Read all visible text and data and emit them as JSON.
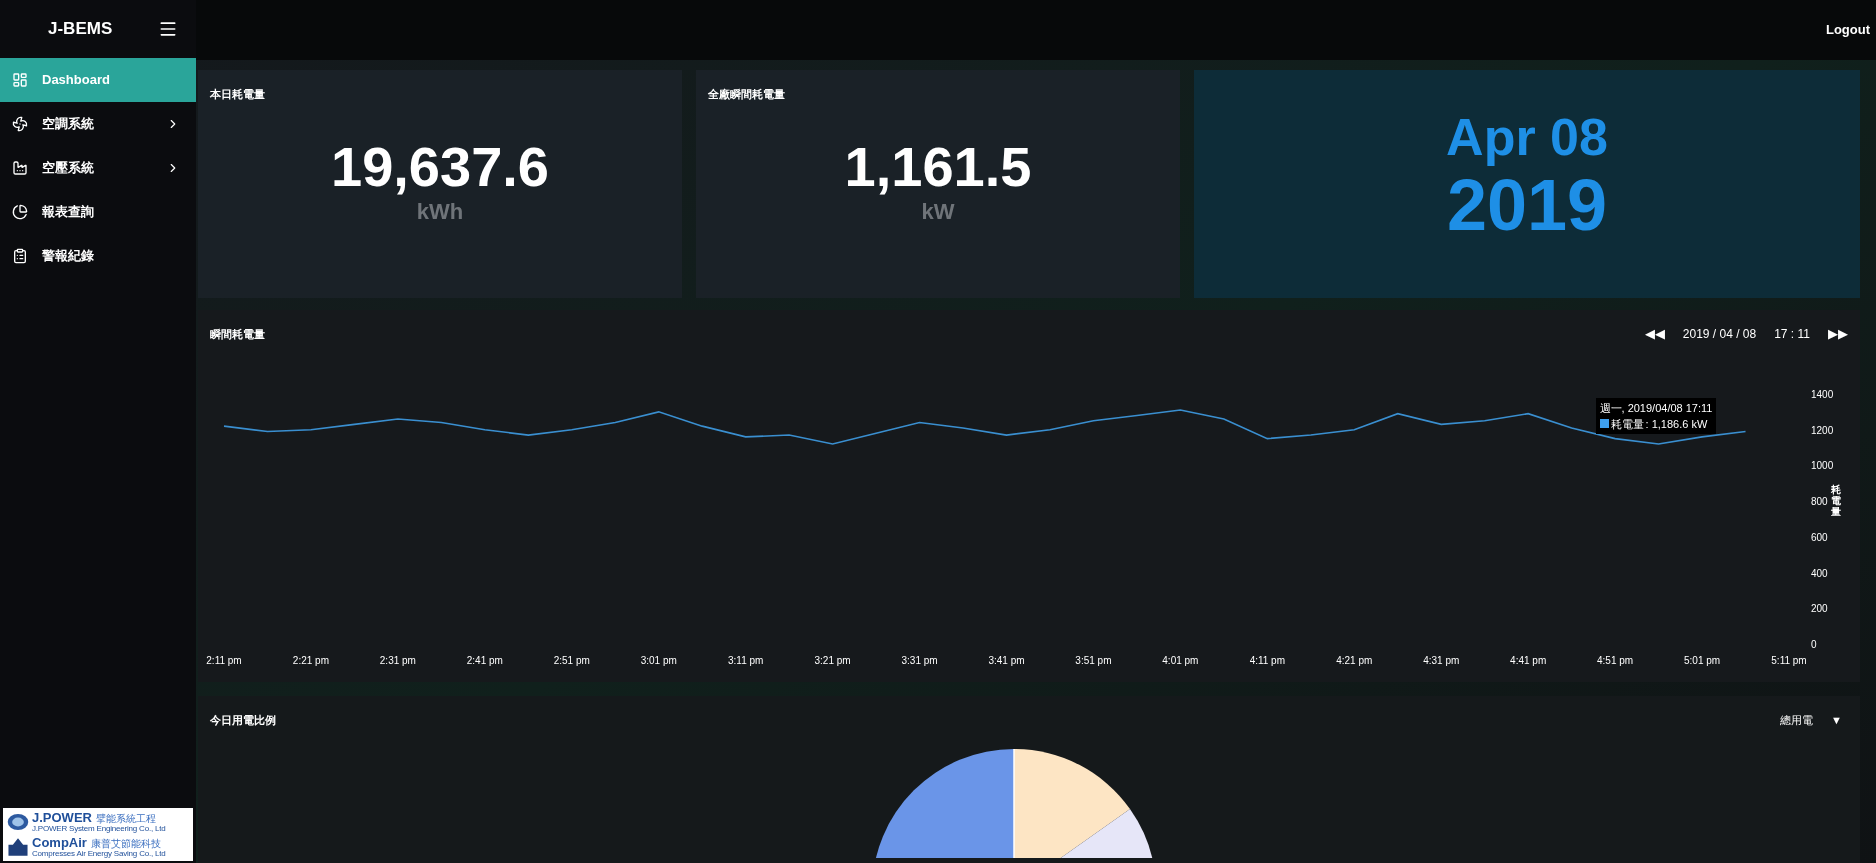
{
  "brand": "J-BEMS",
  "topbar": {
    "logout": "Logout"
  },
  "sidebar": {
    "items": [
      {
        "label": "Dashboard",
        "selected": true,
        "expandable": false
      },
      {
        "label": "空調系統",
        "selected": false,
        "expandable": true
      },
      {
        "label": "空壓系統",
        "selected": false,
        "expandable": true
      },
      {
        "label": "報表查詢",
        "selected": false,
        "expandable": false
      },
      {
        "label": "警報紀錄",
        "selected": false,
        "expandable": false
      }
    ],
    "logos": [
      {
        "name": "J.POWER",
        "local": "擘能系統工程",
        "sub": "J.POWER System Engineering Co., Ltd"
      },
      {
        "name": "CompAir",
        "local": "康普艾節能科技",
        "sub": "Compresses Air Energy Saving Co., Ltd"
      }
    ]
  },
  "stats": [
    {
      "title": "本日耗電量",
      "value": "19,637.6",
      "unit": "kWh"
    },
    {
      "title": "全廠瞬間耗電量",
      "value": "1,161.5",
      "unit": "kW"
    }
  ],
  "date": {
    "day": "Apr 08",
    "year": "2019"
  },
  "trend": {
    "title": "瞬間耗電量",
    "prev": "◀◀",
    "date": "2019 / 04 / 08",
    "time": "17 : 11",
    "next": "▶▶",
    "tooltip": {
      "title": "週一, 2019/04/08 17:11",
      "value": ": 1,186.6 kW",
      "color": "#3ea0f0"
    },
    "chart_data": {
      "type": "line",
      "ylabel": "耗電量",
      "ylim": [
        0,
        1400
      ],
      "categories": [
        "2:11 pm",
        null,
        "2:21 pm",
        null,
        "2:31 pm",
        null,
        "2:41 pm",
        null,
        "2:51 pm",
        null,
        "3:01 pm",
        null,
        "3:11 pm",
        null,
        "3:21 pm",
        null,
        "3:31 pm",
        null,
        "3:41 pm",
        null,
        "3:51 pm",
        null,
        "4:01 pm",
        null,
        "4:11 pm",
        null,
        "4:21 pm",
        null,
        "4:31 pm",
        null,
        "4:41 pm",
        null,
        "4:51 pm",
        null,
        "5:01 pm",
        null,
        "5:11 pm"
      ],
      "series": [
        {
          "name": "耗電量",
          "color": "#3a8fd0",
          "values": [
            1220,
            1190,
            1200,
            1230,
            1260,
            1240,
            1200,
            1170,
            1200,
            1240,
            1300,
            1220,
            1160,
            1170,
            1120,
            1180,
            1240,
            1210,
            1170,
            1200,
            1250,
            1280,
            1310,
            1260,
            1150,
            1170,
            1200,
            1290,
            1230,
            1250,
            1290,
            1210,
            1150,
            1120,
            1160,
            1190,
            null
          ]
        }
      ],
      "yticks": [
        0,
        200,
        400,
        600,
        800,
        1000,
        1200,
        1400
      ]
    }
  },
  "ratio": {
    "title": "今日用電比例",
    "filter": "總用電",
    "caret": "▼"
  }
}
